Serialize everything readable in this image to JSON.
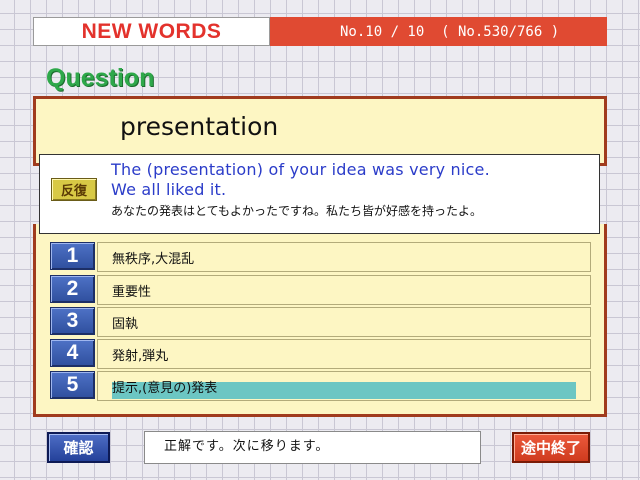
{
  "header": {
    "title": "NEW WORDS",
    "progress": "No.10 / 10  ( No.530/766 )"
  },
  "question": {
    "label": "Question",
    "word": "presentation"
  },
  "example": {
    "repeat_label": "反復",
    "english_line1": "The (presentation) of your idea was very nice.",
    "english_line2": "We all liked it.",
    "japanese": "あなたの発表はとてもよかったですね。私たち皆が好感を持ったよ。"
  },
  "choices": [
    {
      "number": "1",
      "text": "無秩序,大混乱"
    },
    {
      "number": "2",
      "text": "重要性"
    },
    {
      "number": "3",
      "text": "固執"
    },
    {
      "number": "4",
      "text": "発射,弾丸"
    },
    {
      "number": "5",
      "text": "提示,(意見の)発表"
    }
  ],
  "selected_choice": "5",
  "footer": {
    "confirm_label": "確認",
    "status_text": "正解です。次に移ります。",
    "quit_label": "途中終了"
  },
  "colors": {
    "title_red": "#e3322c",
    "header_bar": "#e04a32",
    "question_green": "#2ea84a",
    "panel_yellow": "#fdf6c3",
    "panel_border": "#a03b1d",
    "example_blue": "#2b3cc9",
    "number_button_blue": "#2f4f9e",
    "selection_teal": "#6cc6c3"
  }
}
